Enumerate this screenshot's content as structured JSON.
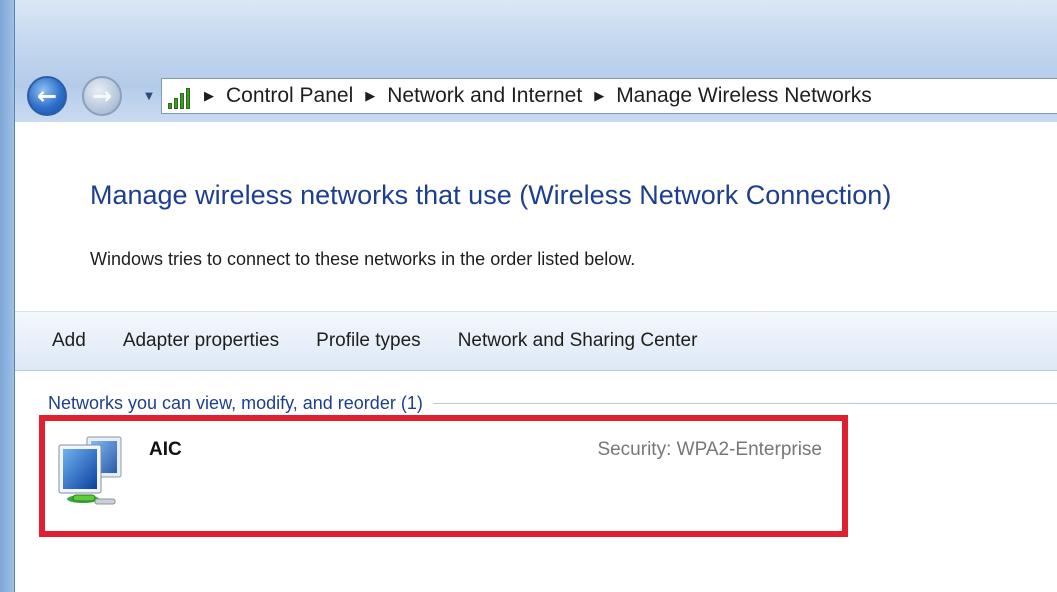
{
  "address_bar": {
    "crumbs": [
      "Control Panel",
      "Network and Internet",
      "Manage Wireless Networks"
    ]
  },
  "page": {
    "title": "Manage wireless networks that use (Wireless Network Connection)",
    "subtitle": "Windows tries to connect to these networks in the order listed below."
  },
  "toolbar": {
    "items": [
      "Add",
      "Adapter properties",
      "Profile types",
      "Network and Sharing Center"
    ]
  },
  "networks_group": {
    "header": "Networks you can view, modify, and reorder (1)",
    "items": [
      {
        "name": "AIC",
        "security_label": "Security:",
        "security_value": "WPA2-Enterprise"
      }
    ]
  },
  "colors": {
    "title_blue": "#1e3f8f",
    "highlight_red": "#e02030"
  },
  "icons": {
    "back": "back-arrow-icon",
    "forward": "forward-arrow-icon",
    "address": "network-signal-icon",
    "network": "wireless-network-icon"
  }
}
